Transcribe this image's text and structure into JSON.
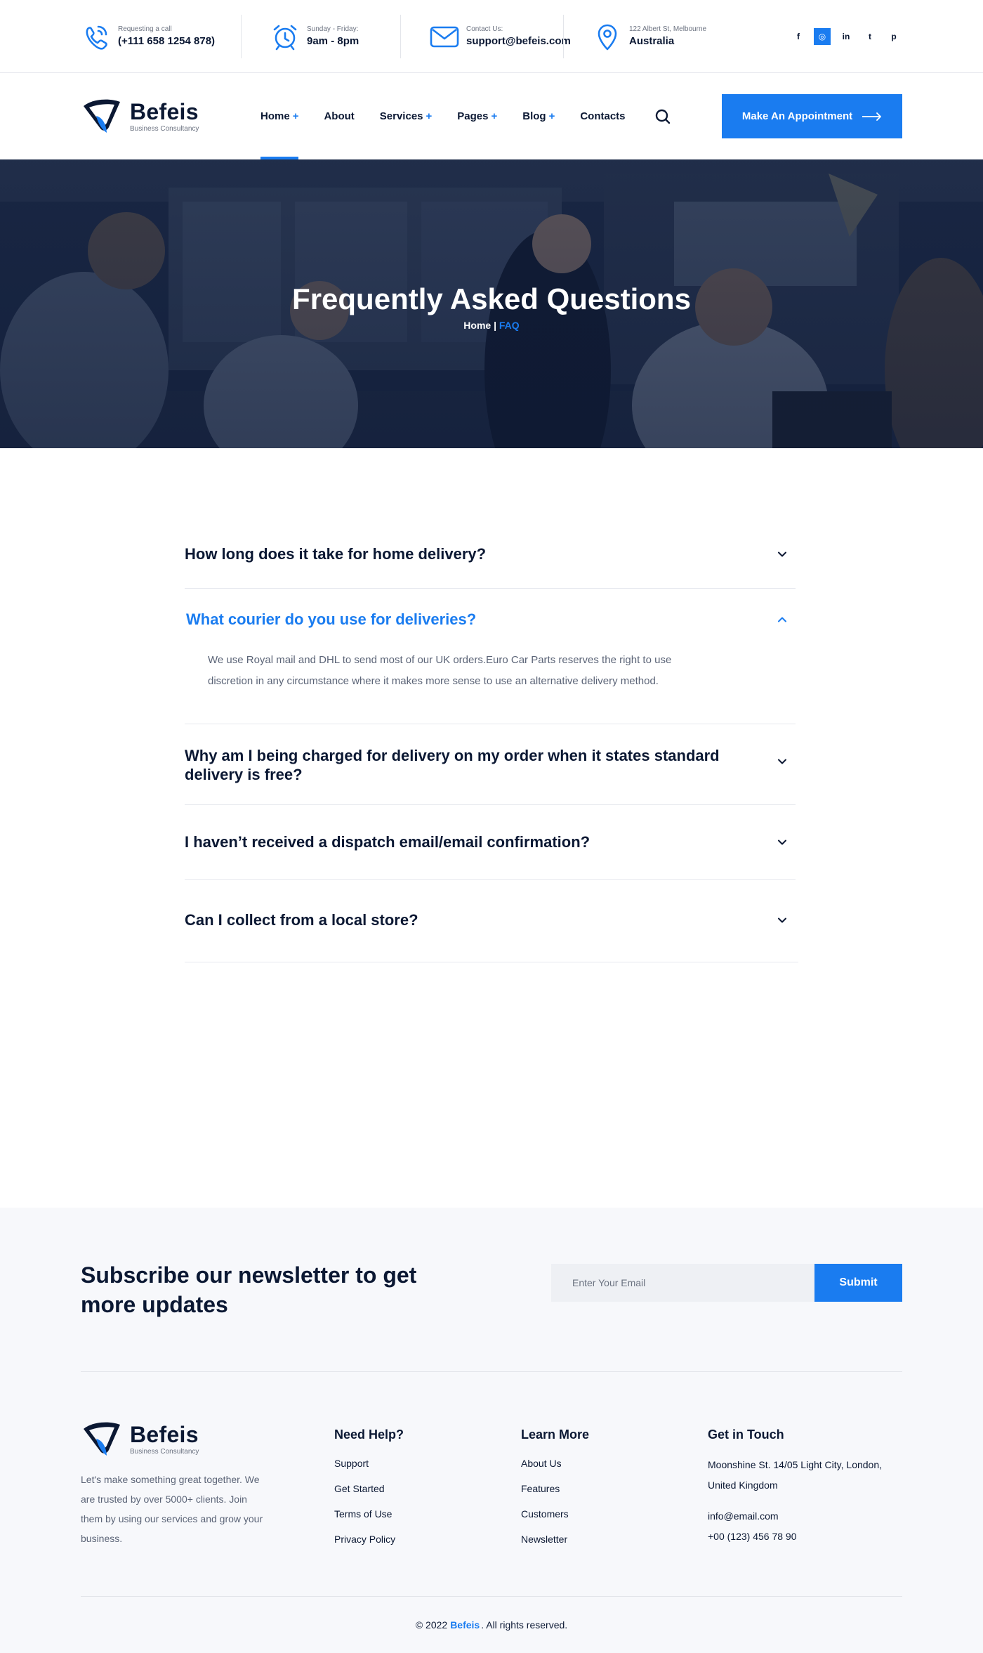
{
  "topbar": {
    "call_label": "Requesting a call",
    "call_value": "(+111 658 1254 878)",
    "hours_label": "Sunday - Friday:",
    "hours_value": "9am - 8pm",
    "contact_label": "Contact Us:",
    "contact_value": "support@befeis.com",
    "address_label": "122 Albert St, Melbourne",
    "address_value": "Australia",
    "socials": [
      {
        "icon": "facebook-icon",
        "glyph": "f"
      },
      {
        "icon": "dribbble-icon",
        "glyph": "◎"
      },
      {
        "icon": "linkedin-icon",
        "glyph": "in"
      },
      {
        "icon": "twitter-icon",
        "glyph": "t"
      },
      {
        "icon": "pinterest-icon",
        "glyph": "p"
      }
    ]
  },
  "header": {
    "logo_name": "Befeis",
    "logo_tagline": "Business Consultancy",
    "nav": [
      {
        "label": "Home",
        "plus": "+"
      },
      {
        "label": "About",
        "plus": ""
      },
      {
        "label": "Services",
        "plus": "+"
      },
      {
        "label": "Pages",
        "plus": "+"
      },
      {
        "label": "Blog",
        "plus": "+"
      },
      {
        "label": "Contacts",
        "plus": ""
      }
    ],
    "cta_label": "Make An Appointment"
  },
  "hero": {
    "title": "Frequently Asked Questions",
    "crumb_home": "Home",
    "crumb_sep": " | ",
    "crumb_current": "FAQ"
  },
  "faq": {
    "items": [
      {
        "question": "How long does it take for home delivery?",
        "open": false
      },
      {
        "question": "What courier do you use for deliveries?",
        "open": true,
        "answer": "We use Royal mail and DHL to send most of our UK orders.Euro Car Parts reserves the right to use discretion in any circumstance where it makes more sense to use an alternative delivery method."
      },
      {
        "question": "Why am I being charged for delivery on my order when it states standard delivery is free?",
        "open": false
      },
      {
        "question": "I haven’t received a dispatch email/email confirmation?",
        "open": false
      },
      {
        "question": "Can I collect from a local store?",
        "open": false
      }
    ]
  },
  "newsletter": {
    "title": "Subscribe our newsletter to get more updates",
    "placeholder": "Enter Your Email",
    "button": "Submit"
  },
  "footer": {
    "about": "Let's make something great together. We are trusted by over 5000+ clients. Join them by using our services and grow your business.",
    "col_help": {
      "title": "Need Help?",
      "links": [
        "Support",
        "Get Started",
        "Terms of Use",
        "Privacy Policy"
      ]
    },
    "col_learn": {
      "title": "Learn More",
      "links": [
        "About Us",
        "Features",
        "Customers",
        "Newsletter"
      ]
    },
    "col_touch": {
      "title": "Get in Touch",
      "address": "Moonshine St. 14/05 Light City, London, United Kingdom",
      "email": "info@email.com",
      "phone": "+00 (123) 456 78 90"
    },
    "copyright_pre": "© 2022",
    "copyright_brand": "Befeis",
    "copyright_post": ". All rights reserved."
  },
  "colors": {
    "accent": "#1a7cf0",
    "heading": "#0b1833",
    "body_text": "#5b6477",
    "footer_bg": "#f7f8fb"
  }
}
